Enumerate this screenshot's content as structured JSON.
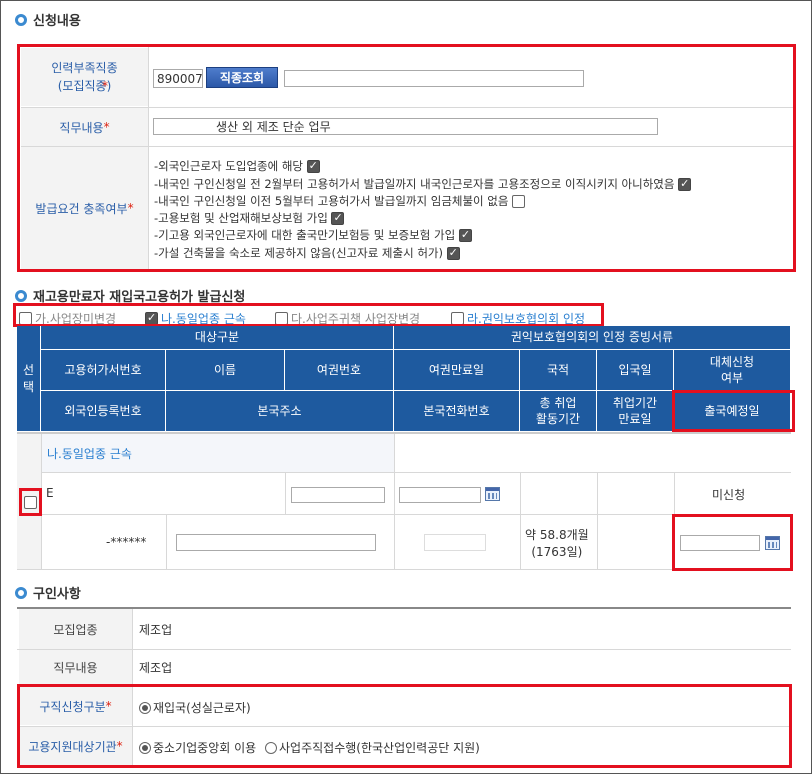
{
  "section1": {
    "title": "신청내용",
    "job_label": "인력부족직종\n(모집직종)",
    "job_code": "890007",
    "job_search_button": "직종조회",
    "job_name_value": "",
    "duty_label": "직무내용",
    "duty_value": "생산 외 제조 단순 업무",
    "criteria_label": "발급요건 충족여부",
    "criteria": [
      {
        "text": "-외국인근로자 도입업종에 해당",
        "checked": true
      },
      {
        "text": "-내국인 구인신청일 전 2월부터 고용허가서 발급일까지 내국인근로자를 고용조정으로 이직시키지 아니하였음",
        "checked": true
      },
      {
        "text": "-내국인 구인신청일 이전 5월부터 고용허가서 발급일까지 임금체불이 없음",
        "checked": false
      },
      {
        "text": "-고용보험 및 산업재해보상보험 가입",
        "checked": true
      },
      {
        "text": "-기고용 외국인근로자에 대한 출국만기보험등 및 보증보험 가입",
        "checked": true
      },
      {
        "text": "-가설 건축물을 숙소로 제공하지 않음(신고자료 제출시 허가)",
        "checked": true
      }
    ]
  },
  "section2": {
    "title": "재고용만료자 재입국고용허가 발급신청",
    "tabs": [
      {
        "label": "가.사업장미변경",
        "checked": false
      },
      {
        "label": "나.동일업종 근속",
        "checked": true
      },
      {
        "label": "다.사업주귀책 사업장변경",
        "checked": false
      },
      {
        "label": "라.권익보호협의회 인정",
        "checked": false
      }
    ],
    "headers": {
      "select": "선\n택",
      "target": "대상구분",
      "proof": "권익보호협의회의 인정 증빙서류",
      "permit_no": "고용허가서번호",
      "name": "이름",
      "passport_no": "여권번호",
      "passport_exp": "여권만료일",
      "nationality": "국적",
      "entry_date": "입국일",
      "replace": "대체신청\n여부",
      "alien_reg": "외국인등록번호",
      "home_addr": "본국주소",
      "home_phone": "본국전화번호",
      "total_work": "총 취업\n활동기간",
      "work_exp": "취업기간\n만료일",
      "departure": "출국예정일"
    },
    "group_label": "나.동일업종 근속",
    "row": {
      "id_prefix": "E",
      "reg_no": "-******",
      "replace_status": "미신청",
      "total_work": "약 58.8개월\n(1763일)"
    }
  },
  "section3": {
    "title": "구인사항",
    "industry_label": "모집업종",
    "industry_value": "제조업",
    "duty_label": "직무내용",
    "duty_value": "제조업",
    "jobseek_label": "구직신청구분",
    "jobseek_option": "재입국(성실근로자)",
    "agency_label": "고용지원대상기관",
    "agency_options": [
      "중소기업중앙회 이용",
      "사업주직접수행(한국산업인력공단 지원)"
    ]
  },
  "colors": {
    "accent_red": "#e3101f",
    "header_blue": "#1e5a9f",
    "label_blue": "#2a5ea8"
  }
}
